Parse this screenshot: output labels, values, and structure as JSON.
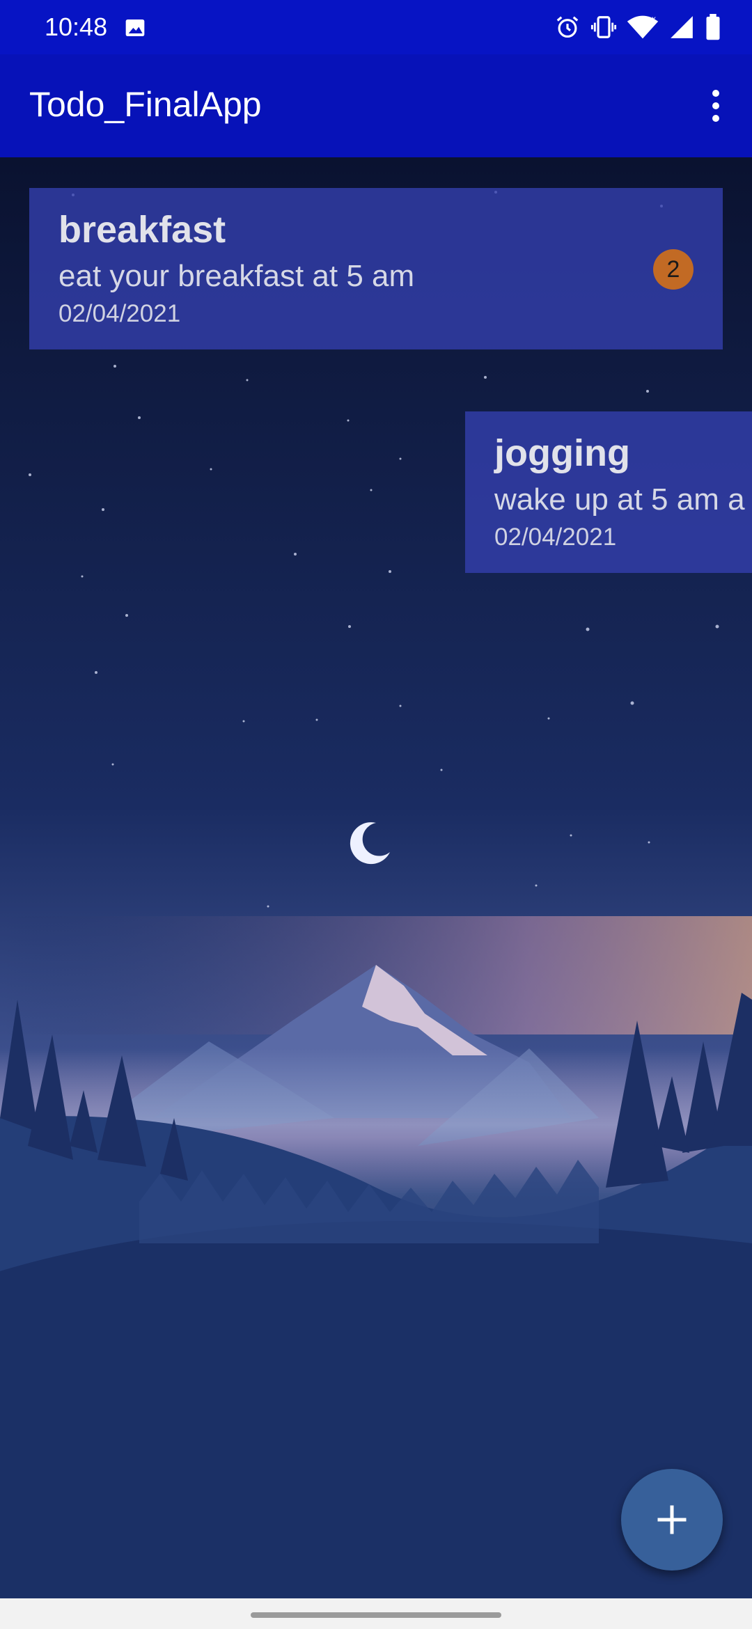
{
  "status_bar": {
    "time": "10:48",
    "icons": [
      "image-icon",
      "alarm-icon",
      "vibrate-icon",
      "wifi-icon",
      "signal-icon",
      "battery-icon"
    ]
  },
  "app_bar": {
    "title": "Todo_FinalApp",
    "menu_icon": "more-vert-icon"
  },
  "todos": [
    {
      "title": "breakfast",
      "description": "eat your breakfast at 5 am",
      "date": "02/04/2021",
      "badge": "2"
    },
    {
      "title": "jogging",
      "description": "wake up at 5 am a",
      "date": "02/04/2021"
    }
  ],
  "fab": {
    "icon": "add-icon"
  },
  "colors": {
    "status_bar": "#0714c4",
    "app_bar": "#0712b8",
    "card": "#3440b0",
    "badge": "#c26a24",
    "fab": "#37609a"
  }
}
